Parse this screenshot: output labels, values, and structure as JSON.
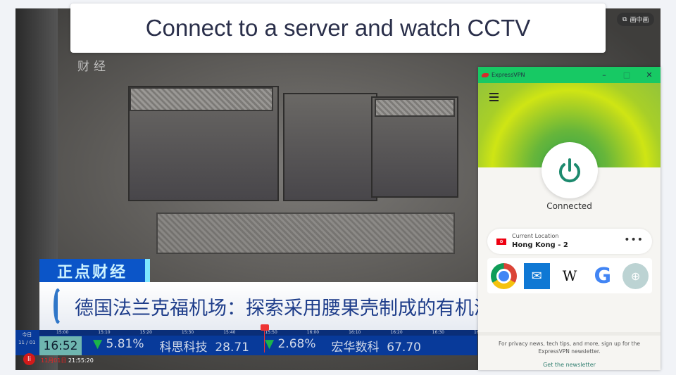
{
  "banner": {
    "title": "Connect to a server and watch CCTV"
  },
  "video": {
    "channel_logo": "财经",
    "pip_label": "画中画",
    "program_tag": "正点财经",
    "headline": "德国法兰克福机场：探索采用腰果壳制成的有机沥",
    "today_label": "今日",
    "today_date": "11 / 01",
    "timeline": [
      "15:00",
      "15:10",
      "15:20",
      "15:30",
      "15:40",
      "15:50",
      "16:00",
      "16:10",
      "16:20",
      "16:30",
      "16:40"
    ],
    "clock": "16:52",
    "ticker": [
      {
        "change": "5.81%",
        "direction": "down"
      },
      {
        "name": "科思科技",
        "price": "28.71"
      },
      {
        "change": "2.68%",
        "direction": "down"
      },
      {
        "name": "宏华数科",
        "price": "67.70"
      }
    ],
    "date": "11月01日",
    "time": "21:55:20"
  },
  "vpn": {
    "app_name": "ExpressVPN",
    "status": "Connected",
    "location_label": "Current Location",
    "location": "Hong Kong - 2",
    "more": "•••",
    "shortcuts": [
      "chrome",
      "mail",
      "wikipedia",
      "google",
      "add"
    ],
    "wiki_glyph": "W",
    "google_glyph": "G",
    "footer_text": "For privacy news, tech tips, and more, sign up for the ExpressVPN newsletter.",
    "footer_link": "Get the newsletter",
    "colors": {
      "titlebar": "#17c964",
      "hero": "#cfe514",
      "power": "#1d8a6e"
    }
  }
}
